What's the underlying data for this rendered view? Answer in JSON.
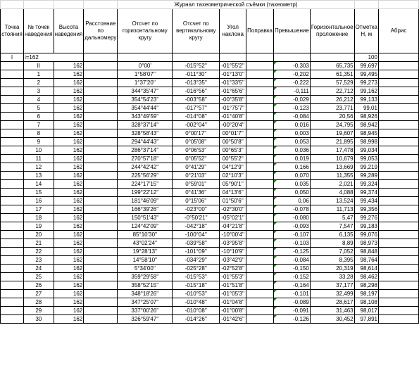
{
  "title": "Журнал тахеометрической съёмки (тахеометр)",
  "headers": [
    "Точка стояния",
    "№ точек наведения",
    "Высота наведения",
    "Расстояние по дальномеру",
    "Отсчет по горизонтальному кругу",
    "Отсчет по вертикальному кругу",
    "Угол наклона",
    "Поправка",
    "Превышение",
    "Горизонтальное проложение",
    "Отметка Н, м",
    "Абрис"
  ],
  "station_row": {
    "station": "I",
    "target": "i=162",
    "elevation": "100"
  },
  "rows": [
    [
      "II",
      "162",
      "",
      "0°00'",
      "-015°52''",
      "-01°55'2''",
      "-0,303",
      "65,735",
      "99,697"
    ],
    [
      "1",
      "162",
      "",
      "1°58'07''",
      "-011°30''",
      "-01°13'0''",
      "-0,202",
      "61,351",
      "99,495"
    ],
    [
      "2",
      "162",
      "",
      "1°37'20''",
      "-013°35''",
      "-01°33'5''",
      "-0,222",
      "57,529",
      "99,273"
    ],
    [
      "3",
      "162",
      "",
      "344°35'47''",
      "-016°56''",
      "-01°65'6''",
      "-0,111",
      "22,712",
      "99,162"
    ],
    [
      "4",
      "162",
      "",
      "354°54'23''",
      "-003°58''",
      "-00°35'8''",
      "-0,029",
      "26,212",
      "99,133"
    ],
    [
      "5",
      "162",
      "",
      "354°44'44''",
      "-017°57''",
      "-01°75'7''",
      "-0,123",
      "23,771",
      "99,01"
    ],
    [
      "6",
      "162",
      "",
      "343°49'59''",
      "-014°08''",
      "-01°40'8''",
      "-0,084",
      "20,56",
      "98,926"
    ],
    [
      "7",
      "162",
      "",
      "328°37'14''",
      "-002°04''",
      "-00°20'4''",
      "0,016",
      "24,795",
      "98,942"
    ],
    [
      "8",
      "162",
      "",
      "328°58'43''",
      "0°00'17''",
      "00°01'7''",
      "0,003",
      "19,607",
      "98,945"
    ],
    [
      "9",
      "162",
      "",
      "294°44'43''",
      "0°05'08''",
      "00°50'8''",
      "0,053",
      "21,895",
      "98,998"
    ],
    [
      "10",
      "162",
      "",
      "286°37'14''",
      "0°06'53''",
      "00°65'3''",
      "0,036",
      "17,478",
      "99,034"
    ],
    [
      "11",
      "162",
      "",
      "270°57'18''",
      "0°05'52''",
      "00°55'2''",
      "0,019",
      "10,679",
      "99,053"
    ],
    [
      "12",
      "162",
      "",
      "244°42'42''",
      "0°41'29''",
      "04°12'9''",
      "0,166",
      "13,669",
      "99,219"
    ],
    [
      "13",
      "162",
      "",
      "225°56'29''",
      "0°21'03''",
      "02°10'3''",
      "0,070",
      "11,355",
      "99,289"
    ],
    [
      "14",
      "162",
      "",
      "224°17'15''",
      "0°59'01''",
      "05°90'1''",
      "0,035",
      "2,021",
      "99,324"
    ],
    [
      "15",
      "162",
      "",
      "199°22'12''",
      "0°41'36''",
      "04°13'6''",
      "0,050",
      "4,088",
      "99,374"
    ],
    [
      "16",
      "162",
      "",
      "181°46'09''",
      "0°15'06''",
      "01°50'6''",
      "0,06",
      "13,524",
      "99,434"
    ],
    [
      "17",
      "162",
      "",
      "166°39'26''",
      "-023°00''",
      "-02°30'0''",
      "-0,078",
      "11,713",
      "99,356"
    ],
    [
      "18",
      "162",
      "",
      "150°51'43''",
      "-0°50'21''",
      "-05°02'1''",
      "-0,080",
      "5,47",
      "99,276"
    ],
    [
      "19",
      "162",
      "",
      "124°42'09''",
      "-042°18''",
      "-04°21'8''",
      "-0,093",
      "7,547",
      "99,183"
    ],
    [
      "20",
      "162",
      "",
      "85°10'30''",
      "-100°04''",
      "-10°00'4''",
      "-0,107",
      "6,135",
      "99,076"
    ],
    [
      "21",
      "162",
      "",
      "43°02'24''",
      "-039°58''",
      "-03°95'8''",
      "-0,103",
      "8,89",
      "98,973"
    ],
    [
      "22",
      "162",
      "",
      "19°28'13''",
      "-101°09''",
      "-10°10'9''",
      "-0,125",
      "7,052",
      "98,848"
    ],
    [
      "23",
      "162",
      "",
      "14°58'10''",
      "-034°29''",
      "-03°42'9''",
      "-0,084",
      "8,395",
      "98,764"
    ],
    [
      "24",
      "162",
      "",
      "5°34'00''",
      "-025°28''",
      "-02°52'8''",
      "-0,150",
      "20,319",
      "98,614"
    ],
    [
      "25",
      "162",
      "",
      "359°29'58''",
      "-015°53''",
      "-01°55'3''",
      "-0,152",
      "33,28",
      "98,462"
    ],
    [
      "26",
      "162",
      "",
      "358°52'15''",
      "-015°18''",
      "-01°51'8''",
      "-0,164",
      "37,177",
      "98,298"
    ],
    [
      "27",
      "162",
      "",
      "348°18'26''",
      "-010°53''",
      "-01°05'3''",
      "-0,101",
      "32,499",
      "98,197"
    ],
    [
      "28",
      "162",
      "",
      "347°25'07''",
      "-010°48''",
      "-01°04'8''",
      "-0,089",
      "28,617",
      "98,108"
    ],
    [
      "29",
      "162",
      "",
      "337°00'26''",
      "-010°08''",
      "-01°00'8''",
      "-0,091",
      "31,463",
      "98,017"
    ],
    [
      "30",
      "162",
      "",
      "326°59'47''",
      "-014°26''",
      "-01°42'6''",
      "-0,126",
      "30,452",
      "97,891"
    ]
  ]
}
